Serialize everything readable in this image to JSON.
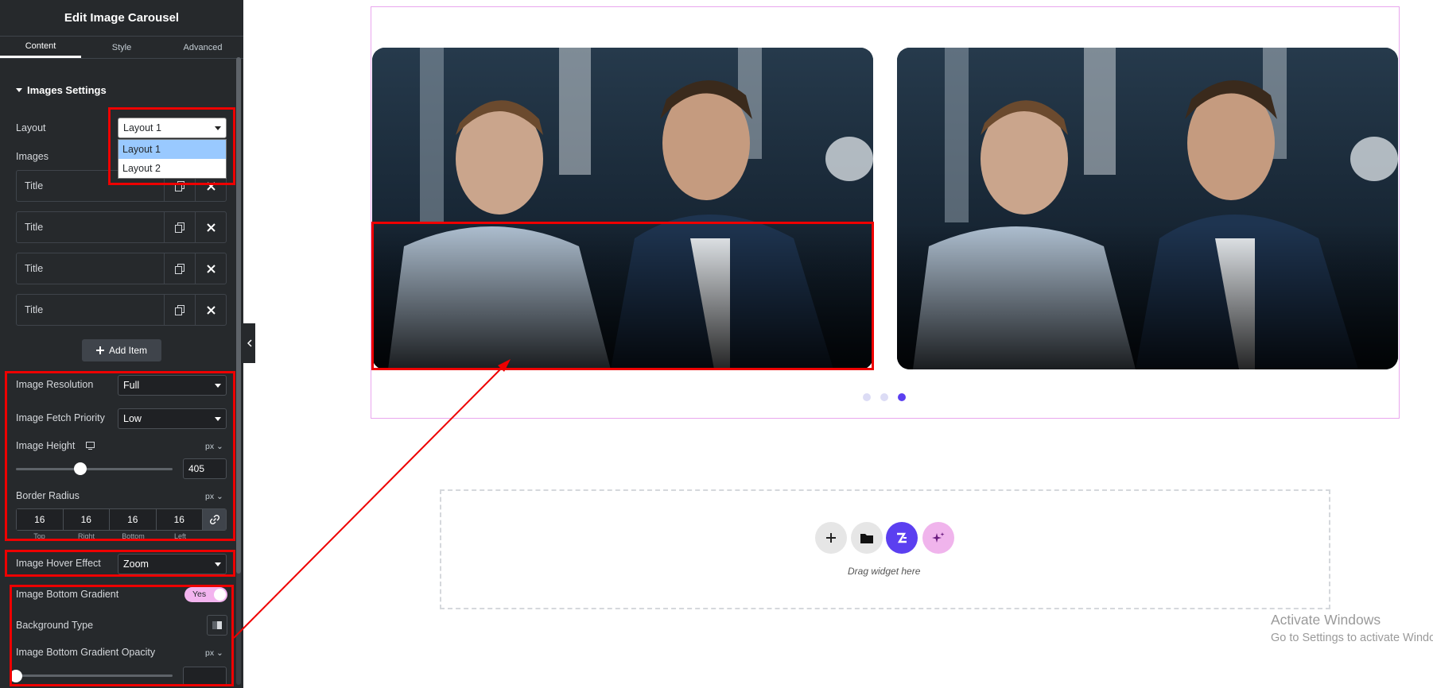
{
  "panel": {
    "title": "Edit Image Carousel",
    "tabs": [
      "Content",
      "Style",
      "Advanced"
    ],
    "section_title": "Images Settings"
  },
  "layout": {
    "label": "Layout",
    "value": "Layout 1",
    "options": [
      "Layout 1",
      "Layout 2"
    ]
  },
  "images": {
    "label": "Images",
    "items": [
      "Title",
      "Title",
      "Title",
      "Title"
    ],
    "add_label": "Add Item"
  },
  "resolution": {
    "label": "Image Resolution",
    "value": "Full"
  },
  "fetch_priority": {
    "label": "Image Fetch Priority",
    "value": "Low"
  },
  "height": {
    "label": "Image Height",
    "unit": "px",
    "value": "405",
    "slider_fraction": 0.41
  },
  "radius": {
    "label": "Border Radius",
    "unit": "px",
    "values": [
      "16",
      "16",
      "16",
      "16"
    ],
    "sides": [
      "Top",
      "Right",
      "Bottom",
      "Left"
    ]
  },
  "hover": {
    "label": "Image Hover Effect",
    "value": "Zoom"
  },
  "gradient": {
    "label": "Image Bottom Gradient",
    "toggle": "Yes",
    "bg_type_label": "Background Type",
    "opacity_label": "Image Bottom Gradient Opacity",
    "opacity_unit": "px",
    "opacity_slider_fraction": 0
  },
  "carousel": {
    "slides": 2,
    "dots": 3,
    "active_dot": 3
  },
  "dropzone": {
    "text": "Drag widget here"
  },
  "watermark": {
    "line1": "Activate Windows",
    "line2": "Go to Settings to activate Windows."
  },
  "colors": {
    "accent": "#5b3ff0",
    "annotation": "#e00000",
    "toggle_on": "#f3b4ef"
  }
}
